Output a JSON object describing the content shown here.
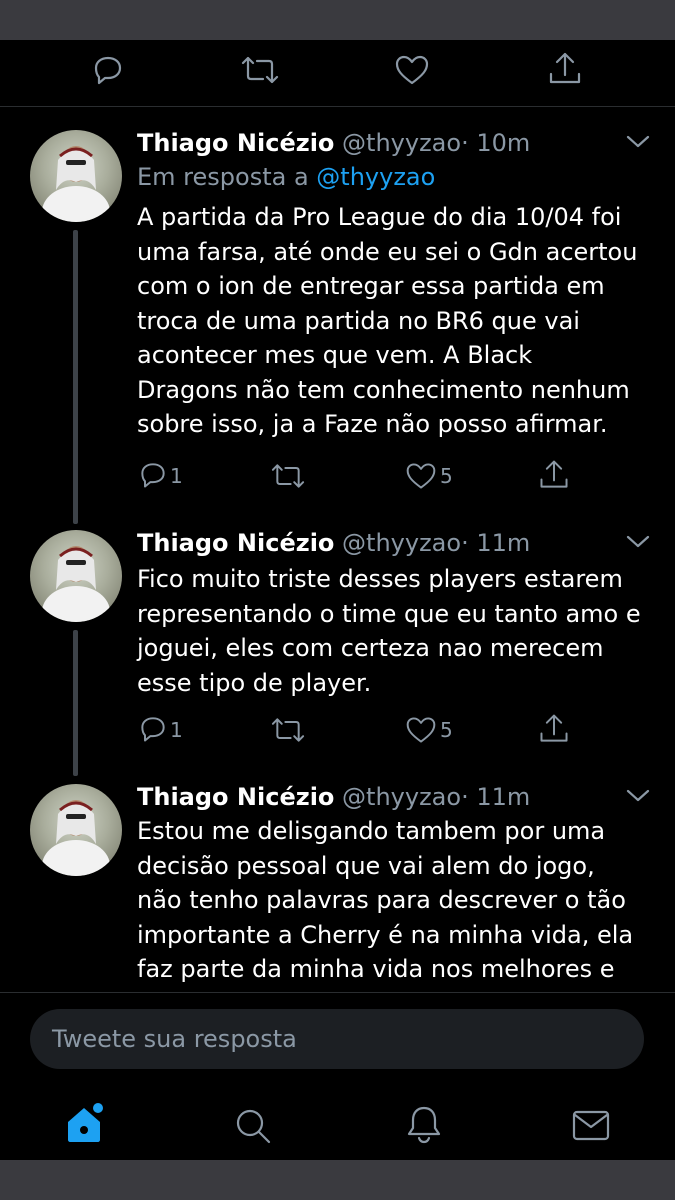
{
  "top_actions": [
    "reply-icon",
    "retweet-icon",
    "like-icon",
    "share-icon"
  ],
  "tweets": [
    {
      "name": "Thiago Nicézio",
      "handle": "@thyyzao",
      "time": "· 10m",
      "reply_prefix": "Em resposta a",
      "reply_mention": "@thyyzao",
      "text": "A partida da Pro League do dia 10/04 foi\numa farsa, até onde eu sei o Gdn acertou\ncom o ion de entregar essa partida em\ntroca de uma partida no BR6 que vai\nacontecer mes que vem. A Black\nDragons não tem conhecimento nenhum\nsobre isso, ja  a Faze não posso afirmar.",
      "replies": "1",
      "likes": "5"
    },
    {
      "name": "Thiago Nicézio",
      "handle": "@thyyzao",
      "time": "· 11m",
      "text": "Fico muito triste desses players estarem\nrepresentando o time que eu tanto amo e\njoguei, eles com certeza nao merecem\nesse tipo de player.",
      "replies": "1",
      "likes": "5"
    },
    {
      "name": "Thiago Nicézio",
      "handle": "@thyyzao",
      "time": "· 11m",
      "text": "Estou me delisgando tambem por uma\ndecisão pessoal que vai alem do jogo,\nnão tenho palavras para descrever o tão\nimportante a Cherry é na minha vida, ela\nfaz parte da minha vida nos melhores e"
    }
  ],
  "compose": {
    "placeholder": "Tweete sua resposta"
  },
  "tabbar": [
    "home-icon",
    "search-icon",
    "notifications-icon",
    "messages-icon"
  ],
  "colors": {
    "accent": "#1da1f2",
    "muted": "#8b98a5",
    "background": "#000000"
  }
}
